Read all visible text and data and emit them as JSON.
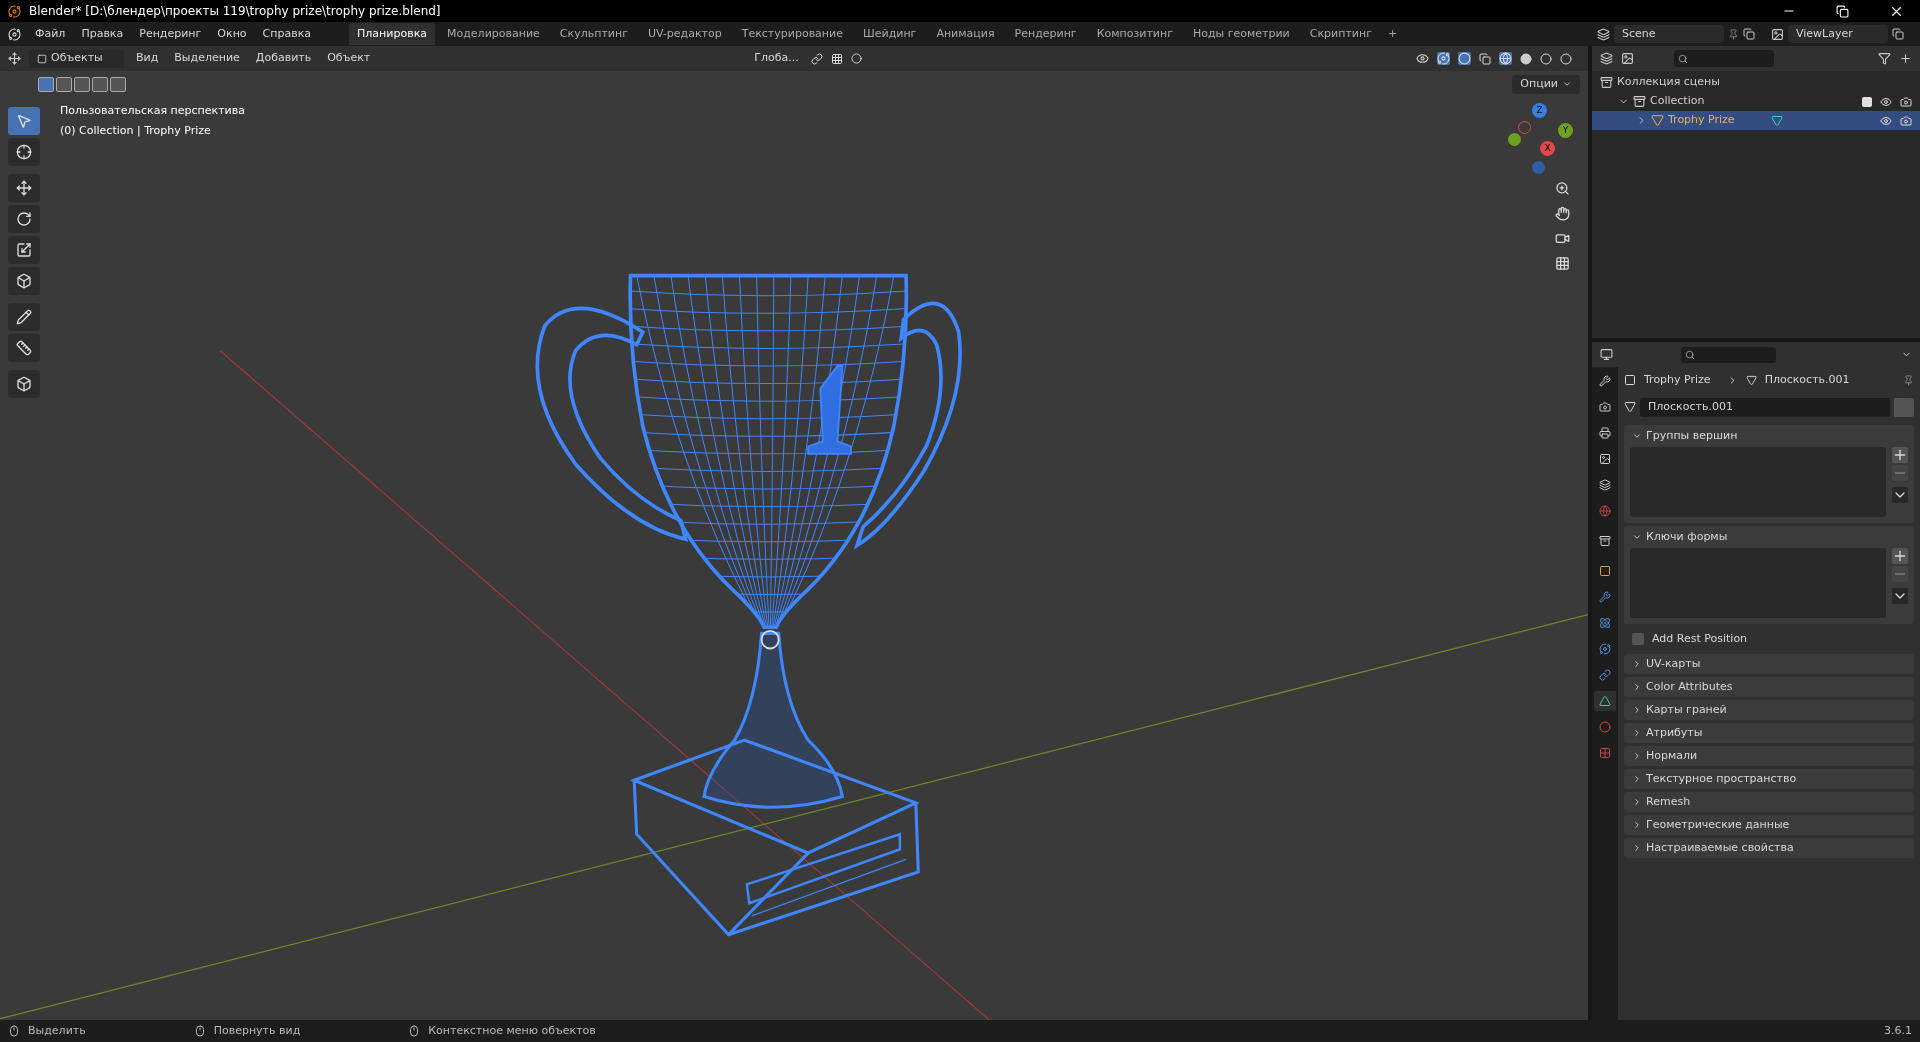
{
  "window": {
    "title": "Blender* [D:\\блендер\\проекты 119\\trophy prize\\trophy prize.blend]"
  },
  "menus": [
    "Файл",
    "Правка",
    "Рендеринг",
    "Окно",
    "Справка"
  ],
  "workspaces": [
    {
      "label": "Планировка",
      "selected": true
    },
    {
      "label": "Моделирование",
      "selected": false
    },
    {
      "label": "Скульптинг",
      "selected": false
    },
    {
      "label": "UV-редактор",
      "selected": false
    },
    {
      "label": "Текстурирование",
      "selected": false
    },
    {
      "label": "Шейдинг",
      "selected": false
    },
    {
      "label": "Анимация",
      "selected": false
    },
    {
      "label": "Рендеринг",
      "selected": false
    },
    {
      "label": "Композитинг",
      "selected": false
    },
    {
      "label": "Ноды геометрии",
      "selected": false
    },
    {
      "label": "Скриптинг",
      "selected": false
    }
  ],
  "add_workspace": "+",
  "scene": {
    "name": "Scene"
  },
  "view_layer": {
    "name": "ViewLayer"
  },
  "viewport": {
    "mode": "Объекты",
    "menus": [
      "Вид",
      "Выделение",
      "Добавить",
      "Объект"
    ],
    "orientation": "Глоба...",
    "options": "Опции",
    "overlay_lines": [
      "Пользовательская перспектива",
      "(0) Collection | Trophy Prize"
    ],
    "gizmo": {
      "z": "Z",
      "y": "Y",
      "x": "X"
    },
    "select_modes": [
      {
        "selected": true
      },
      {
        "selected": false
      },
      {
        "selected": false
      },
      {
        "selected": false
      },
      {
        "selected": false
      }
    ],
    "tools": [
      {
        "kind": "select",
        "selected": true
      },
      {
        "kind": "cursor",
        "selected": false
      },
      {
        "kind": "move",
        "selected": false
      },
      {
        "kind": "rotate",
        "selected": false
      },
      {
        "kind": "scale",
        "selected": false
      },
      {
        "kind": "transform",
        "selected": false
      },
      {
        "kind": "annotate",
        "selected": false
      },
      {
        "kind": "measure",
        "selected": false
      },
      {
        "kind": "add-cube",
        "selected": false
      }
    ]
  },
  "outliner": {
    "tree": [
      {
        "label": "Коллекция сцены",
        "kind": "scene",
        "children": [
          {
            "label": "Collection",
            "kind": "collection",
            "expanded": true,
            "selected": false,
            "children": [
              {
                "label": "Trophy Prize",
                "kind": "object",
                "expanded": false,
                "selected": true
              }
            ]
          }
        ]
      }
    ]
  },
  "properties": {
    "breadcrumb": [
      "Trophy Prize",
      "Плоскость.001"
    ],
    "mesh_name": "Плоскость.001",
    "tabs": [
      {
        "kind": "tool",
        "selected": false
      },
      {
        "kind": "render",
        "selected": false
      },
      {
        "kind": "output",
        "selected": false
      },
      {
        "kind": "view-layer",
        "selected": false
      },
      {
        "kind": "scene",
        "selected": false
      },
      {
        "kind": "world",
        "selected": false
      },
      {
        "kind": "collection",
        "selected": false
      },
      {
        "kind": "object",
        "selected": false
      },
      {
        "kind": "modifiers",
        "selected": false
      },
      {
        "kind": "particles",
        "selected": false
      },
      {
        "kind": "physics",
        "selected": false
      },
      {
        "kind": "constraints",
        "selected": false
      },
      {
        "kind": "data",
        "selected": true
      },
      {
        "kind": "material",
        "selected": false
      },
      {
        "kind": "texture",
        "selected": false
      }
    ],
    "panels": [
      {
        "label": "Группы вершин",
        "kind": "list",
        "expanded": true
      },
      {
        "label": "Ключи формы",
        "kind": "list",
        "expanded": true
      },
      {
        "label": "Add Rest Position",
        "kind": "checkbox",
        "checked": false
      },
      {
        "label": "UV-карты",
        "kind": "panel",
        "expanded": false
      },
      {
        "label": "Color Attributes",
        "kind": "panel",
        "expanded": false
      },
      {
        "label": "Карты граней",
        "kind": "panel",
        "expanded": false
      },
      {
        "label": "Атрибуты",
        "kind": "panel",
        "expanded": false
      },
      {
        "label": "Нормали",
        "kind": "panel",
        "expanded": false
      },
      {
        "label": "Текстурное пространство",
        "kind": "panel",
        "expanded": false
      },
      {
        "label": "Remesh",
        "kind": "panel",
        "expanded": false
      },
      {
        "label": "Геометрические данные",
        "kind": "panel",
        "expanded": false
      },
      {
        "label": "Настраиваемые свойства",
        "kind": "panel",
        "expanded": false
      }
    ]
  },
  "status_bar": {
    "hints": [
      "Выделить",
      "Повернуть вид",
      "Контекстное меню объектов"
    ],
    "version": "3.6.1"
  }
}
